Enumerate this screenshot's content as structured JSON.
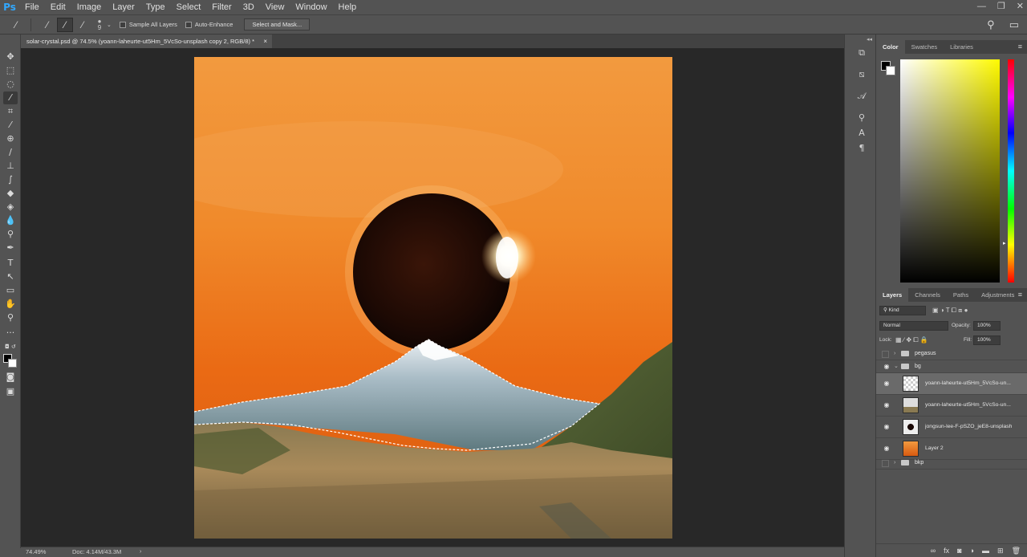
{
  "app": {
    "logo": "Ps"
  },
  "menu": [
    "File",
    "Edit",
    "Image",
    "Layer",
    "Type",
    "Select",
    "Filter",
    "3D",
    "View",
    "Window",
    "Help"
  ],
  "window_controls": {
    "minimize": "—",
    "restore": "❐",
    "close": "✕"
  },
  "options": {
    "brush_size": "9",
    "sample_all_layers": "Sample All Layers",
    "auto_enhance": "Auto-Enhance",
    "select_and_mask": "Select and Mask..."
  },
  "document_tab": {
    "title": "solar-crystal.psd @ 74.5% (yoann-laheurte-ut5Hm_5VcSo-unsplash copy 2, RGB/8) *",
    "close": "×"
  },
  "status": {
    "zoom": "74.49%",
    "doc": "Doc: 4.14M/43.3M",
    "arrow": "›"
  },
  "color_panel": {
    "tabs": [
      "Color",
      "Swatches",
      "Libraries"
    ],
    "active_tab": "Color",
    "foreground": "#000000",
    "background": "#ffffff"
  },
  "layers_panel": {
    "tabs": [
      "Layers",
      "Channels",
      "Paths",
      "Adjustments"
    ],
    "active_tab": "Layers",
    "filter": "Kind",
    "blend_mode": "Normal",
    "opacity_label": "Opacity:",
    "opacity": "100%",
    "lock_label": "Lock:",
    "fill_label": "Fill:",
    "fill": "100%",
    "groups": {
      "pegasus": "pegasus",
      "bg": "bg",
      "bkp": "bkp"
    },
    "layers": [
      {
        "name": "yoann-laheurte-ut5Hm_5VcSo-un...",
        "selected": true
      },
      {
        "name": "yoann-laheurte-ut5Hm_5VcSo-un...",
        "selected": false
      },
      {
        "name": "jongsun-lee-F-pSZO_jeE8-unsplash",
        "selected": false
      },
      {
        "name": "Layer 2",
        "selected": false
      }
    ]
  }
}
